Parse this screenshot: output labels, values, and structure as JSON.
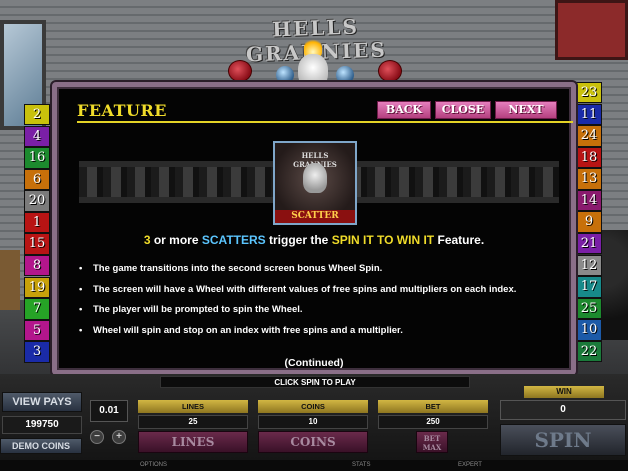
{
  "logo": {
    "text": "HELLS GRANNIES"
  },
  "left_lines": [
    {
      "n": "2",
      "bg": "#c9c10c"
    },
    {
      "n": "4",
      "bg": "#7a1fa6"
    },
    {
      "n": "16",
      "bg": "#1c8a2e"
    },
    {
      "n": "6",
      "bg": "#c7700a"
    },
    {
      "n": "20",
      "bg": "#7b7b7b"
    },
    {
      "n": "1",
      "bg": "#b81414"
    },
    {
      "n": "15",
      "bg": "#b81414"
    },
    {
      "n": "8",
      "bg": "#b3168c"
    },
    {
      "n": "19",
      "bg": "#c7a10a"
    },
    {
      "n": "7",
      "bg": "#26a326"
    },
    {
      "n": "5",
      "bg": "#b3168c"
    },
    {
      "n": "3",
      "bg": "#1a2ba8"
    }
  ],
  "right_lines": [
    {
      "n": "23",
      "bg": "#c9c10c"
    },
    {
      "n": "11",
      "bg": "#1a2ba8"
    },
    {
      "n": "24",
      "bg": "#c7700a"
    },
    {
      "n": "18",
      "bg": "#b81414"
    },
    {
      "n": "13",
      "bg": "#c7700a"
    },
    {
      "n": "14",
      "bg": "#8a1a6e"
    },
    {
      "n": "9",
      "bg": "#c7700a"
    },
    {
      "n": "21",
      "bg": "#7a1fa6"
    },
    {
      "n": "12",
      "bg": "#8a8a8a"
    },
    {
      "n": "17",
      "bg": "#178a8a"
    },
    {
      "n": "25",
      "bg": "#1c8a2e"
    },
    {
      "n": "10",
      "bg": "#1c5aa8"
    },
    {
      "n": "22",
      "bg": "#1a7a3a"
    }
  ],
  "panel": {
    "title": "FEATURE",
    "back_label": "BACK",
    "close_label": "CLOSE",
    "next_label": "NEXT",
    "scatter_label": "SCATTER",
    "scatter_logo": "HELLS GRANNIES",
    "trigger": {
      "count": "3",
      "part1": "or more",
      "scatters": "SCATTERS",
      "part2": "trigger the",
      "spin": "SPIN IT TO WIN IT",
      "part3": "Feature."
    },
    "bullets": [
      "The game transitions into the second screen bonus Wheel Spin.",
      "The screen will have a Wheel with different values of free spins and multipliers on each index.",
      "The player will be prompted to spin the Wheel.",
      "Wheel will spin and stop on an index with free spins and a multiplier."
    ],
    "continued": "(Continued)"
  },
  "console": {
    "click_to_play": "CLICK SPIN TO PLAY",
    "win_label": "WIN",
    "win_value": "0",
    "view_pays": "VIEW PAYS",
    "credits": "199750",
    "demo_coins": "DEMO COINS",
    "coin_size": "0.01",
    "minus": "−",
    "plus": "+",
    "lines_label": "LINES",
    "lines_value": "25",
    "lines_btn": "LINES",
    "coins_label": "COINS",
    "coins_value": "10",
    "coins_btn": "COINS",
    "bet_label": "BET",
    "bet_value": "250",
    "bet_max_btn": "BET MAX",
    "spin_btn": "SPIN",
    "footer": {
      "options": "OPTIONS",
      "stats": "STATS",
      "expert": "EXPERT"
    }
  }
}
